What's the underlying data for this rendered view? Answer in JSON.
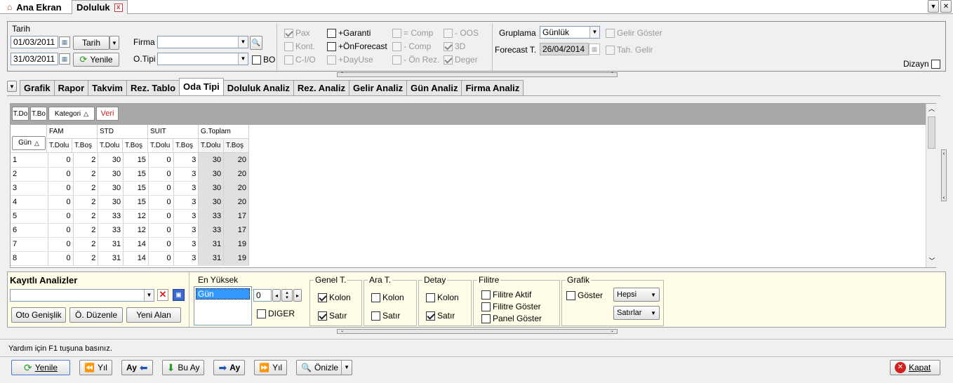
{
  "doc_tabs": {
    "home": "Ana Ekran",
    "active": "Doluluk",
    "close": "x"
  },
  "filters": {
    "tarih_label": "Tarih",
    "date1": "01/03/2011",
    "date2": "31/03/2011",
    "tarih_btn": "Tarih",
    "yenile_btn": "Yenile",
    "firma_label": "Firma",
    "otipi_label": "O.Tipi",
    "bo_label": "BO"
  },
  "options": {
    "pax": "Pax",
    "kont": "Kont.",
    "cio": "C-I/O",
    "garanti": "+Garanti",
    "onforecast": "+ÖnForecast",
    "dayuse": "+DayUse",
    "comp_eq": "= Comp",
    "comp_minus": "- Comp",
    "onrez": "- Ön Rez.",
    "oos": "- OOS",
    "d3": "3D",
    "deger": "Deger"
  },
  "grouping": {
    "gruplama_label": "Gruplama",
    "gruplama_value": "Günlük",
    "forecast_label": "Forecast T.",
    "forecast_value": "26/04/2014",
    "gelir_goster": "Gelir Göster",
    "tah_gelir": "Tah. Gelir",
    "dizayn": "Dizayn"
  },
  "analysis_tabs": [
    "Grafik",
    "Rapor",
    "Takvim",
    "Rez. Tablo",
    "Oda Tipi",
    "Doluluk Analiz",
    "Rez. Analiz",
    "Gelir Analiz",
    "Gün Analiz",
    "Firma Analiz"
  ],
  "pivot": {
    "fields": [
      "T.Do",
      "T.Bo",
      "Kategori",
      "Veri"
    ],
    "row_header": "Gün",
    "groups": [
      "FAM",
      "STD",
      "SUIT",
      "G.Toplam"
    ],
    "subcols": [
      "T.Dolu",
      "T.Boş",
      "T.Dolu",
      "T.Boş",
      "T.Dolu",
      "T.Boş",
      "T.Dolu",
      "T.Boş"
    ],
    "rows": [
      [
        "1",
        "0",
        "2",
        "30",
        "15",
        "0",
        "3",
        "30",
        "20"
      ],
      [
        "2",
        "0",
        "2",
        "30",
        "15",
        "0",
        "3",
        "30",
        "20"
      ],
      [
        "3",
        "0",
        "2",
        "30",
        "15",
        "0",
        "3",
        "30",
        "20"
      ],
      [
        "4",
        "0",
        "2",
        "30",
        "15",
        "0",
        "3",
        "30",
        "20"
      ],
      [
        "5",
        "0",
        "2",
        "33",
        "12",
        "0",
        "3",
        "33",
        "17"
      ],
      [
        "6",
        "0",
        "2",
        "33",
        "12",
        "0",
        "3",
        "33",
        "17"
      ],
      [
        "7",
        "0",
        "2",
        "31",
        "14",
        "0",
        "3",
        "31",
        "19"
      ],
      [
        "8",
        "0",
        "2",
        "31",
        "14",
        "0",
        "3",
        "31",
        "19"
      ]
    ]
  },
  "saved": {
    "title": "Kayıtlı Analizler",
    "oto": "Oto Genişlik",
    "duzenle": "Ö. Düzenle",
    "yeni": "Yeni Alan"
  },
  "en_yuksek": {
    "title": "En Yüksek",
    "selected": "Gün",
    "spin_value": "0",
    "diger": "DIGER"
  },
  "genel": {
    "title": "Genel T.",
    "kolon": "Kolon",
    "satir": "Satır"
  },
  "ara": {
    "title": "Ara T.",
    "kolon": "Kolon",
    "satir": "Satır"
  },
  "detay": {
    "title": "Detay",
    "kolon": "Kolon",
    "satir": "Satır"
  },
  "filitre": {
    "title": "Filitre",
    "aktif": "Filitre Aktif",
    "goster": "Filitre Göster",
    "panel": "Panel Göster"
  },
  "grafik": {
    "title": "Grafik",
    "goster": "Göster",
    "hepsi": "Hepsi",
    "satirlar": "Satırlar"
  },
  "status": "Yardım için F1 tuşuna basınız.",
  "bottom": {
    "yenile": "Yenile",
    "yil_back": "Yıl",
    "ay_back": "Ay",
    "bu_ay": "Bu Ay",
    "ay_fwd": "Ay",
    "yil_fwd": "Yıl",
    "onizle": "Önizle",
    "kapat": "Kapat"
  }
}
